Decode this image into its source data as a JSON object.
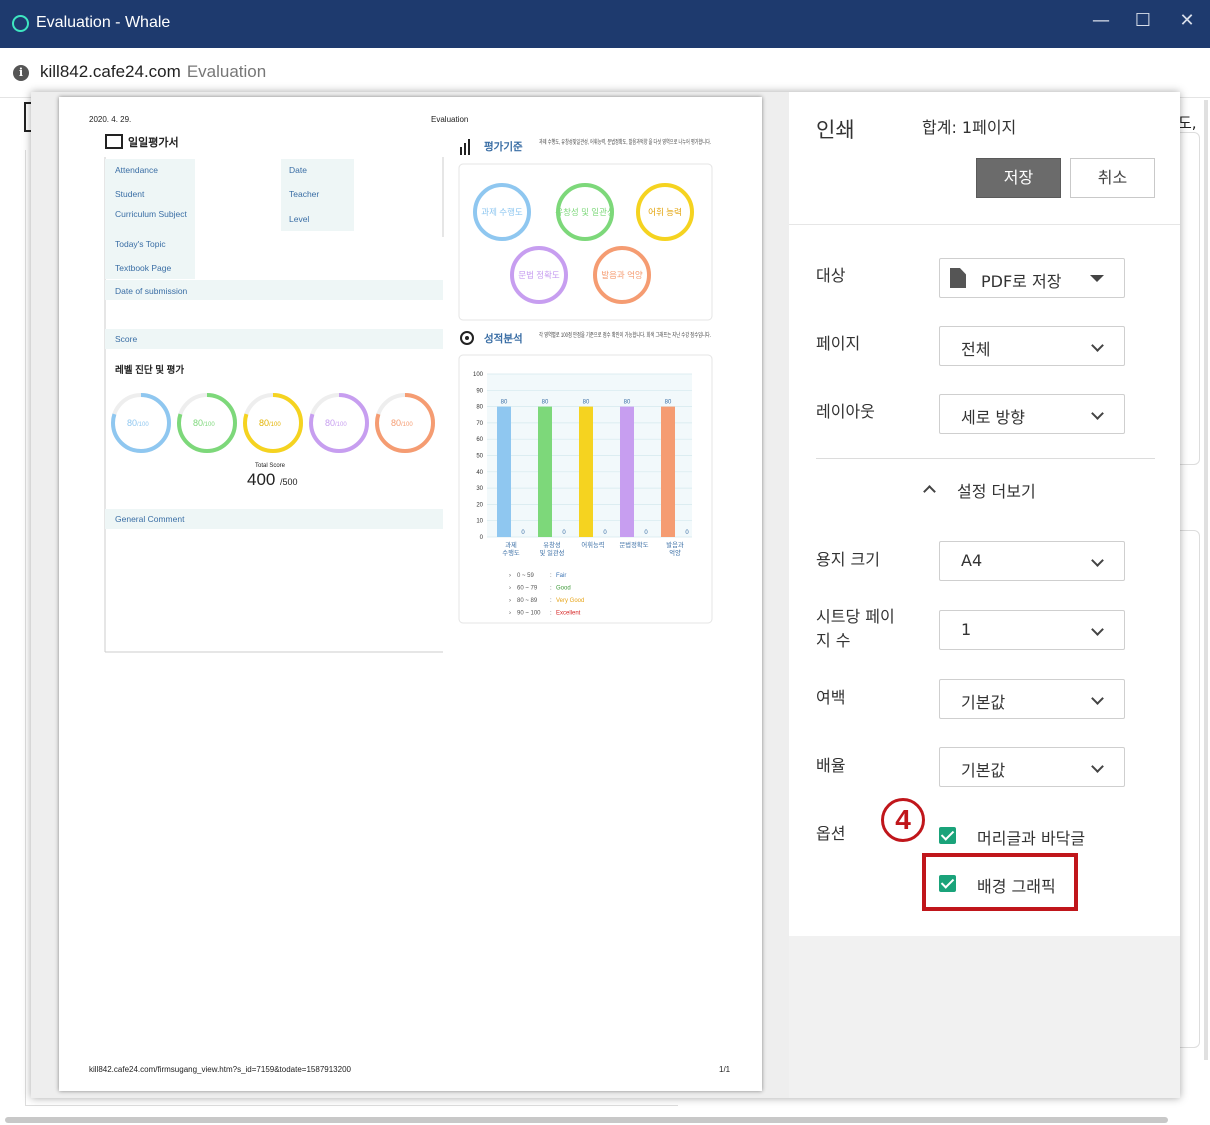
{
  "window": {
    "title": "Evaluation - Whale",
    "controls": {
      "minimize": "—",
      "maximize": "☐",
      "close": "✕"
    }
  },
  "address_bar": {
    "url": "kill842.cafe24.com",
    "page_title": "Evaluation"
  },
  "background": {
    "edge_text": "도,"
  },
  "print_preview": {
    "header_date": "2020. 4. 29.",
    "header_title": "Evaluation",
    "footer_url": "kill842.cafe24.com/firmsugang_view.htm?s_id=7159&todate=1587913200",
    "footer_page": "1/1",
    "form_title": "일일평가서",
    "left_fields": [
      "Attendance",
      "Student",
      "Curriculum Subject",
      "Today's Topic",
      "Textbook Page",
      "Date of submission"
    ],
    "right_fields": [
      "Date",
      "Teacher",
      "Level"
    ],
    "score_label": "Score",
    "level_title": "레벨 진단 및 평가",
    "rings": [
      {
        "value": "80",
        "max": "/100",
        "color": "#8fc7f0"
      },
      {
        "value": "80",
        "max": "/100",
        "color": "#7dd87a"
      },
      {
        "value": "80",
        "max": "/100",
        "color": "#f5d320"
      },
      {
        "value": "80",
        "max": "/100",
        "color": "#c79ef0"
      },
      {
        "value": "80",
        "max": "/100",
        "color": "#f59c72"
      }
    ],
    "total_score_label": "Total Score",
    "total_score_value": "400",
    "total_score_max": "/500",
    "general_comment": "General Comment",
    "criteria_title": "평가기준",
    "criteria_desc": "과제 수행도, 유창성및일관성, 어휘능력, 문법정확도, 발음과억양 을 다섯 영역으로 나누어 평가합니다.",
    "criteria_circles": [
      {
        "label": "과제 수행도",
        "color": "#8fc7f0"
      },
      {
        "label": "유창성 및 일관성",
        "color": "#7dd87a"
      },
      {
        "label": "어휘 능력",
        "color": "#f5d320"
      },
      {
        "label": "문법 정확도",
        "color": "#c79ef0"
      },
      {
        "label": "발음과 억양",
        "color": "#f59c72"
      }
    ],
    "analysis_title": "성적분석",
    "analysis_desc": "각 영역별로 100점 만점을 기준으로 점수 확인이 가능합니다. 회색 그래프는 지난 수강 점수입니다.",
    "legend": [
      {
        "range": "0 ~  59",
        "label": "Fair",
        "color": "#3a73b5"
      },
      {
        "range": "60 ~  79",
        "label": "Good",
        "color": "#3f9a3a"
      },
      {
        "range": "80 ~  89",
        "label": "Very Good",
        "color": "#e7a51b"
      },
      {
        "range": "90 ~ 100",
        "label": "Excellent",
        "color": "#d62525"
      }
    ]
  },
  "chart_data": {
    "type": "bar",
    "categories": [
      "과제 수행도",
      "유창성 및 일관성",
      "어휘능력",
      "문법정확도",
      "발음과 억양"
    ],
    "series": [
      {
        "name": "",
        "values": [
          80,
          80,
          80,
          80,
          80
        ],
        "colors": [
          "#8fc7f0",
          "#7dd87a",
          "#f5d320",
          "#c79ef0",
          "#f59c72"
        ]
      },
      {
        "name": "",
        "values": [
          0,
          0,
          0,
          0,
          0
        ],
        "colors": [
          "#bbbbbb",
          "#bbbbbb",
          "#bbbbbb",
          "#bbbbbb",
          "#bbbbbb"
        ]
      }
    ],
    "yticks": [
      "100",
      "90",
      "80",
      "70",
      "60",
      "50",
      "40",
      "30",
      "20",
      "10",
      "0"
    ],
    "ylim": [
      0,
      100
    ],
    "grid": true
  },
  "print_settings": {
    "title": "인쇄",
    "total": "합계: 1페이지",
    "save_label": "저장",
    "cancel_label": "취소",
    "destination_label": "대상",
    "destination_value": "PDF로 저장",
    "pages_label": "페이지",
    "pages_value": "전체",
    "layout_label": "레이아웃",
    "layout_value": "세로 방향",
    "more_settings": "설정 더보기",
    "paper_size_label": "용지 크기",
    "paper_size_value": "A4",
    "pages_per_sheet_label_1": "시트당 페이",
    "pages_per_sheet_label_2": "지 수",
    "pages_per_sheet_value": "1",
    "margins_label": "여백",
    "margins_value": "기본값",
    "scale_label": "배율",
    "scale_value": "기본값",
    "options_label": "옵션",
    "option_headers_footers": "머리글과 바닥글",
    "option_headers_footers_checked": true,
    "option_background_graphics": "배경 그래픽",
    "option_background_graphics_checked": true,
    "annotation_number": "4",
    "annotation_color": "#c0161b"
  }
}
